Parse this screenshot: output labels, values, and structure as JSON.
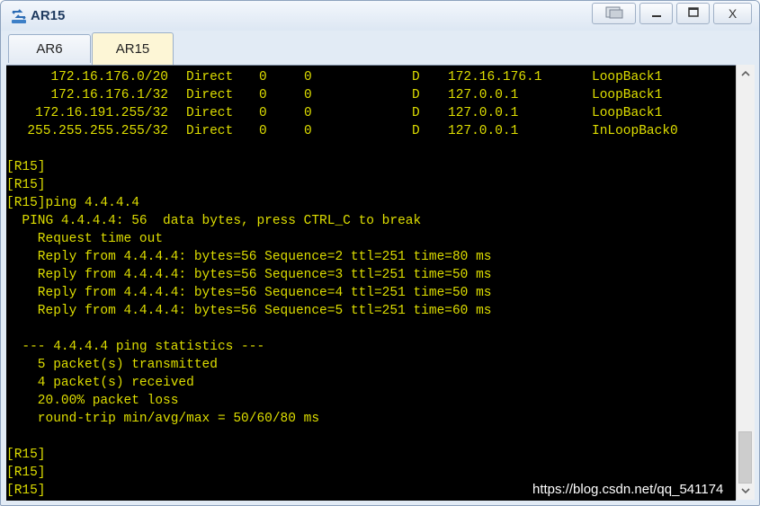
{
  "window": {
    "title": "AR15",
    "icon": "router-network-icon",
    "controls": [
      "restore-console-icon",
      "minimize-icon",
      "maximize-icon",
      "close-icon"
    ],
    "close_label": "X"
  },
  "tabs": [
    {
      "label": "AR6",
      "active": false
    },
    {
      "label": "AR15",
      "active": true
    }
  ],
  "colors": {
    "terminal_bg": "#000000",
    "terminal_text": "#dede00",
    "active_tab": "#fdf6d6"
  },
  "routes": [
    {
      "dest": "172.16.176.0/20",
      "proto": "Direct",
      "pre": "0",
      "cost": "0",
      "flags": "D",
      "nexthop": "172.16.176.1",
      "iface": "LoopBack1"
    },
    {
      "dest": "172.16.176.1/32",
      "proto": "Direct",
      "pre": "0",
      "cost": "0",
      "flags": "D",
      "nexthop": "127.0.0.1",
      "iface": "LoopBack1"
    },
    {
      "dest": "172.16.191.255/32",
      "proto": "Direct",
      "pre": "0",
      "cost": "0",
      "flags": "D",
      "nexthop": "127.0.0.1",
      "iface": "LoopBack1"
    },
    {
      "dest": "255.255.255.255/32",
      "proto": "Direct",
      "pre": "0",
      "cost": "0",
      "flags": "D",
      "nexthop": "127.0.0.1",
      "iface": "InLoopBack0"
    }
  ],
  "lines": [
    "[R15]",
    "[R15]",
    "[R15]ping 4.4.4.4",
    "  PING 4.4.4.4: 56  data bytes, press CTRL_C to break",
    "    Request time out",
    "    Reply from 4.4.4.4: bytes=56 Sequence=2 ttl=251 time=80 ms",
    "    Reply from 4.4.4.4: bytes=56 Sequence=3 ttl=251 time=50 ms",
    "    Reply from 4.4.4.4: bytes=56 Sequence=4 ttl=251 time=50 ms",
    "    Reply from 4.4.4.4: bytes=56 Sequence=5 ttl=251 time=60 ms",
    "",
    "  --- 4.4.4.4 ping statistics ---",
    "    5 packet(s) transmitted",
    "    4 packet(s) received",
    "    20.00% packet loss",
    "    round-trip min/avg/max = 50/60/80 ms",
    "",
    "[R15]",
    "[R15]",
    "[R15]"
  ],
  "watermark": "https://blog.csdn.net/qq_541174",
  "scrollbar": {
    "position": 1.0
  }
}
